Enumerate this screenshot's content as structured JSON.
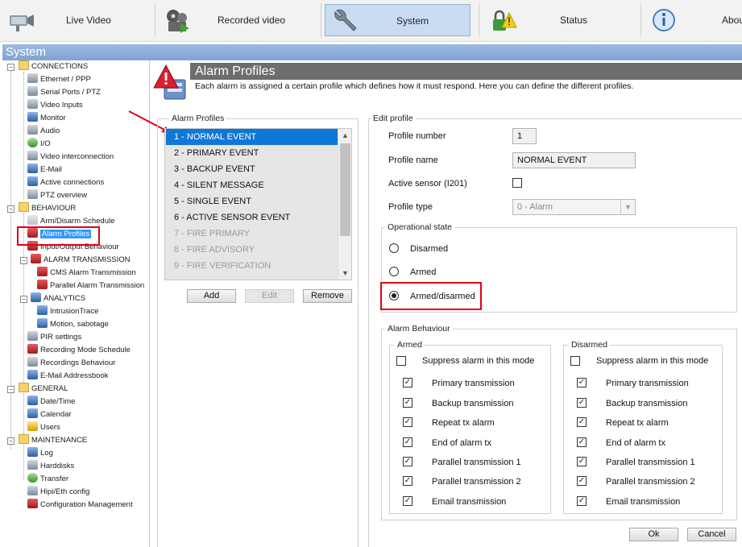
{
  "topnav": {
    "tabs": [
      {
        "label": "Live Video",
        "icon": "camera-icon"
      },
      {
        "label": "Recorded video",
        "icon": "film-reel-icon"
      },
      {
        "label": "System",
        "icon": "wrench-icon"
      },
      {
        "label": "Status",
        "icon": "padlock-warning-icon"
      },
      {
        "label": "Abou",
        "icon": "info-icon"
      }
    ]
  },
  "section_title": "System",
  "tree": {
    "groups": [
      {
        "label": "CONNECTIONS",
        "items": [
          "Ethernet / PPP",
          "Serial Ports / PTZ",
          "Video Inputs",
          "Monitor",
          "Audio",
          "I/O",
          "Video interconnection",
          "E-Mail",
          "Active connections",
          "PTZ overview"
        ]
      },
      {
        "label": "BEHAVIOUR",
        "items": [
          "Arm/Disarm Schedule",
          "Alarm Profiles",
          "Input/Output Behaviour"
        ]
      },
      {
        "label": "ALARM TRANSMISSION",
        "items": [
          "CMS Alarm Transmission",
          "Parallel Alarm Transmission"
        ]
      },
      {
        "label": "ANALYTICS",
        "items": [
          "IntrusionTrace",
          "Motion, sabotage"
        ]
      },
      {
        "label": "",
        "items": [
          "PIR settings",
          "Recording Mode Schedule",
          "Recordings Behaviour",
          "E-Mail Addressbook"
        ]
      },
      {
        "label": "GENERAL",
        "items": [
          "Date/Time",
          "Calendar",
          "Users"
        ]
      },
      {
        "label": "MAINTENANCE",
        "items": [
          "Log",
          "Harddisks",
          "Transfer",
          "Hipi/Eth config",
          "Configuration Management"
        ]
      }
    ],
    "selected": "Alarm Profiles"
  },
  "page": {
    "title": "Alarm Profiles",
    "description": "Each alarm is assigned a certain profile which defines how it must respond. Here you can define the different profiles."
  },
  "alarm_profiles": {
    "legend": "Alarm Profiles",
    "items": [
      {
        "label": "1 - NORMAL EVENT",
        "selected": true,
        "disabled": false
      },
      {
        "label": "2 - PRIMARY EVENT",
        "selected": false,
        "disabled": false
      },
      {
        "label": "3 - BACKUP EVENT",
        "selected": false,
        "disabled": false
      },
      {
        "label": "4 - SILENT MESSAGE",
        "selected": false,
        "disabled": false
      },
      {
        "label": "5 - SINGLE EVENT",
        "selected": false,
        "disabled": false
      },
      {
        "label": "6 - ACTIVE SENSOR EVENT",
        "selected": false,
        "disabled": false
      },
      {
        "label": "7 - FIRE PRIMARY",
        "selected": false,
        "disabled": true
      },
      {
        "label": "8 - FIRE ADVISORY",
        "selected": false,
        "disabled": true
      },
      {
        "label": "9 - FIRE VERIFICATION",
        "selected": false,
        "disabled": true
      }
    ],
    "buttons": {
      "add": "Add",
      "edit": "Edit",
      "remove": "Remove"
    }
  },
  "edit_profile": {
    "legend": "Edit profile",
    "profile_number_label": "Profile number",
    "profile_number": "1",
    "profile_name_label": "Profile name",
    "profile_name": "NORMAL EVENT",
    "active_sensor_label": "Active sensor (I201)",
    "active_sensor_checked": false,
    "profile_type_label": "Profile type",
    "profile_type": "0 - Alarm",
    "operational_state": {
      "legend": "Operational state",
      "options": [
        "Disarmed",
        "Armed",
        "Armed/disarmed"
      ],
      "selected": "Armed/disarmed"
    },
    "alarm_behaviour": {
      "legend": "Alarm Behaviour",
      "armed": {
        "legend": "Armed",
        "suppress_label": "Suppress alarm in this mode",
        "suppress_checked": false,
        "items": [
          "Primary transmission",
          "Backup transmission",
          "Repeat tx alarm",
          "End of alarm tx",
          "Parallel transmission 1",
          "Parallel transmission 2",
          "Email transmission"
        ],
        "checked": [
          true,
          true,
          true,
          true,
          true,
          true,
          true
        ]
      },
      "disarmed": {
        "legend": "Disarmed",
        "suppress_label": "Suppress alarm in this mode",
        "suppress_checked": false,
        "items": [
          "Primary transmission",
          "Backup transmission",
          "Repeat tx alarm",
          "End of alarm tx",
          "Parallel transmission 1",
          "Parallel transmission 2",
          "Email transmission"
        ],
        "checked": [
          true,
          true,
          true,
          true,
          true,
          true,
          true
        ]
      }
    }
  },
  "footer": {
    "ok": "Ok",
    "cancel": "Cancel"
  },
  "colors": {
    "highlight": "#0f78d7",
    "annotation": "#e0001b",
    "header_band": "#6d6d6d"
  }
}
